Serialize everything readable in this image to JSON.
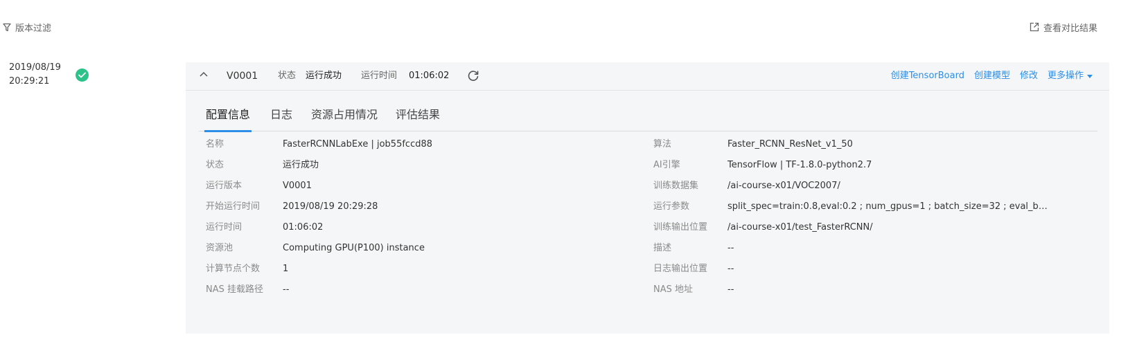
{
  "toolbar": {
    "filter_label": "版本过滤",
    "compare_label": "查看对比结果"
  },
  "run": {
    "date": "2019/08/19",
    "time": "20:29:21",
    "status_color": "#2cc28a"
  },
  "header": {
    "version": "V0001",
    "status_label": "状态",
    "status_value": "运行成功",
    "runtime_label": "运行时间",
    "runtime_value": "01:06:02",
    "actions": [
      "创建TensorBoard",
      "创建模型",
      "修改",
      "更多操作"
    ]
  },
  "tabs": [
    {
      "label": "配置信息",
      "active": true
    },
    {
      "label": "日志",
      "active": false
    },
    {
      "label": "资源占用情况",
      "active": false
    },
    {
      "label": "评估结果",
      "active": false
    }
  ],
  "config_left": [
    {
      "label": "名称",
      "value": "FasterRCNNLabExe | job55fccd88"
    },
    {
      "label": "状态",
      "value": "运行成功"
    },
    {
      "label": "运行版本",
      "value": "V0001"
    },
    {
      "label": "开始运行时间",
      "value": "2019/08/19 20:29:28"
    },
    {
      "label": "运行时间",
      "value": "01:06:02"
    },
    {
      "label": "资源池",
      "value": "Computing GPU(P100) instance"
    },
    {
      "label": "计算节点个数",
      "value": "1"
    },
    {
      "label": "NAS 挂载路径",
      "value": "--"
    }
  ],
  "config_right": [
    {
      "label": "算法",
      "value": "Faster_RCNN_ResNet_v1_50"
    },
    {
      "label": "AI引擎",
      "value": "TensorFlow | TF-1.8.0-python2.7"
    },
    {
      "label": "训练数据集",
      "value": "/ai-course-x01/VOC2007/"
    },
    {
      "label": "运行参数",
      "value": "split_spec=train:0.8,eval:0.2 ; num_gpus=1 ; batch_size=32 ; eval_batc..."
    },
    {
      "label": "训练输出位置",
      "value": "/ai-course-x01/test_FasterRCNN/"
    },
    {
      "label": "描述",
      "value": "--"
    },
    {
      "label": "日志输出位置",
      "value": "--"
    },
    {
      "label": "NAS 地址",
      "value": "--"
    }
  ],
  "colors": {
    "accent": "#2d8ee8",
    "success": "#2cc28a",
    "panel_bg": "#f5f6f7"
  }
}
